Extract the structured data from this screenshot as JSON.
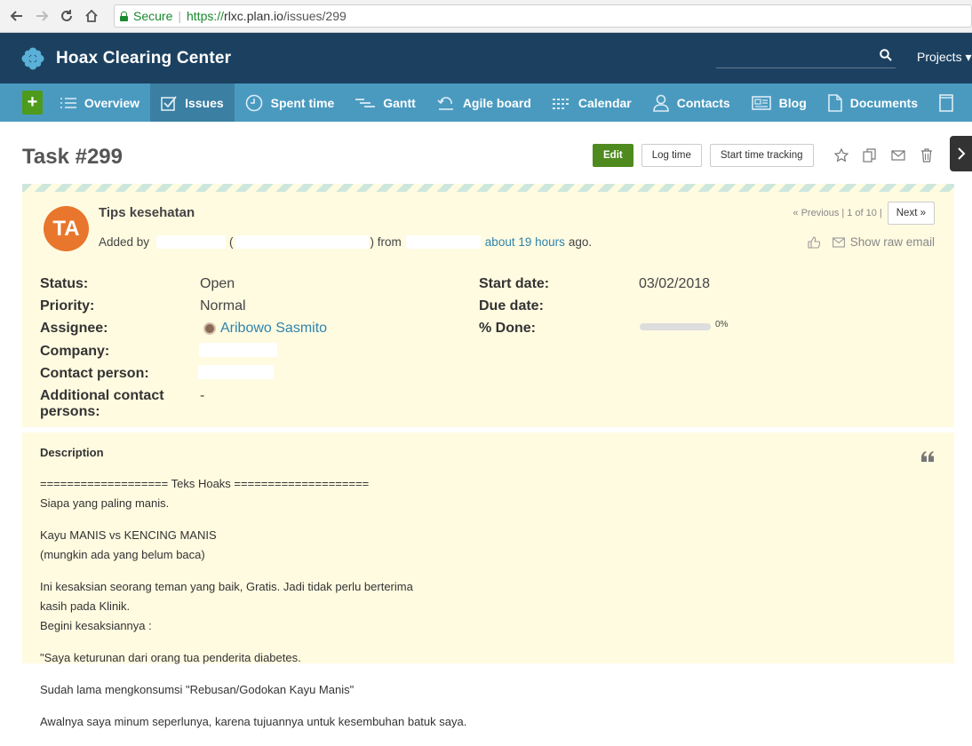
{
  "browser": {
    "secure_label": "Secure",
    "url_scheme": "https://",
    "url_host": "rlxc.plan.io",
    "url_path": "/issues/299"
  },
  "header": {
    "site_title": "Hoax Clearing Center",
    "projects_label": "Projects"
  },
  "menu": {
    "add_label": "+",
    "items": [
      {
        "label": "Overview",
        "icon": "list-icon"
      },
      {
        "label": "Issues",
        "icon": "checkbox-icon"
      },
      {
        "label": "Spent time",
        "icon": "clock-icon"
      },
      {
        "label": "Gantt",
        "icon": "gantt-icon"
      },
      {
        "label": "Agile board",
        "icon": "agile-icon"
      },
      {
        "label": "Calendar",
        "icon": "calendar-icon"
      },
      {
        "label": "Contacts",
        "icon": "contact-icon"
      },
      {
        "label": "Blog",
        "icon": "newspaper-icon"
      },
      {
        "label": "Documents",
        "icon": "document-icon"
      }
    ]
  },
  "issue": {
    "title": "Task #299",
    "actions": {
      "edit": "Edit",
      "log_time": "Log time",
      "start_tracking": "Start time tracking"
    },
    "avatar_initials": "TA",
    "subject": "Tips kesehatan",
    "author_prefix": "Added by",
    "author_open_paren": "(",
    "author_close_from": ") from",
    "time_link": "about 19 hours",
    "time_suffix": "ago.",
    "previous": "« Previous",
    "position": "1 of 10",
    "next": "Next »",
    "raw_email": "Show raw email",
    "attributes_left": [
      {
        "label": "Status:",
        "value": "Open"
      },
      {
        "label": "Priority:",
        "value": "Normal"
      },
      {
        "label": "Assignee:",
        "value": "Aribowo Sasmito"
      },
      {
        "label": "Company:",
        "value": ""
      },
      {
        "label": "Contact person:",
        "value": ""
      },
      {
        "label": "Additional contact",
        "value": "-"
      }
    ],
    "additional_contact_line2": "persons:",
    "attributes_right": [
      {
        "label": "Start date:",
        "value": "03/02/2018"
      },
      {
        "label": "Due date:",
        "value": ""
      },
      {
        "label": "% Done:",
        "value": "0%"
      }
    ],
    "done_ratio": 0,
    "colors": {
      "accent": "#4e8a1e",
      "header": "#1c4160",
      "menu": "#4a9ac0",
      "avatar": "#e8762c"
    }
  },
  "description": {
    "title": "Description",
    "paragraphs": [
      [
        "=================== Teks Hoaks ====================",
        "Siapa yang paling manis."
      ],
      [
        "Kayu MANIS vs KENCING MANIS",
        "(mungkin ada yang belum baca)"
      ],
      [
        "Ini kesaksian seorang teman yang baik, Gratis. Jadi tidak perlu berterima",
        "kasih pada Klinik.",
        "Begini kesaksiannya :"
      ],
      [
        "\"Saya keturunan dari orang tua penderita diabetes."
      ],
      [
        "Sudah lama mengkonsumsi \"Rebusan/Godokan Kayu Manis\""
      ],
      [
        "Awalnya saya minum seperlunya, karena tujuannya untuk kesembuhan batuk saya."
      ]
    ]
  }
}
